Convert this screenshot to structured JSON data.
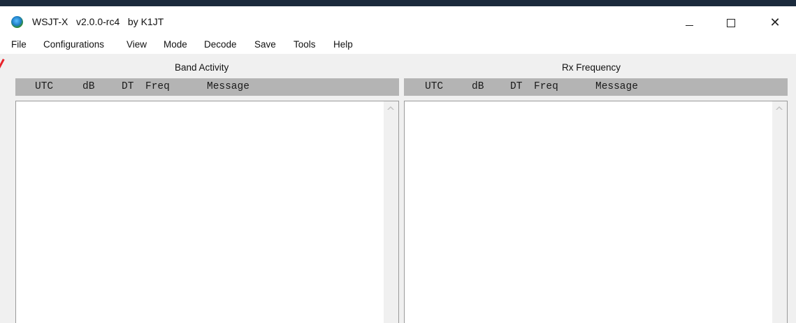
{
  "window": {
    "title": "WSJT-X   v2.0.0-rc4   by K1JT",
    "minimize_glyph": "—",
    "maximize_glyph": "☐",
    "close_glyph": "✕",
    "icon": "wsjtx-globe-icon"
  },
  "menu": {
    "items": [
      "File",
      "Configurations",
      "View",
      "Mode",
      "Decode",
      "Save",
      "Tools",
      "Help"
    ]
  },
  "band_activity": {
    "title": "Band Activity",
    "columns": [
      "UTC",
      "dB",
      "DT",
      "Freq",
      "Message"
    ]
  },
  "rx_frequency": {
    "title": "Rx Frequency",
    "columns": [
      "UTC",
      "dB",
      "DT",
      "Freq",
      "Message"
    ]
  },
  "colors": {
    "header_gray": "#b4b4b4",
    "accent_red": "#e8232a",
    "top_strip": "#1b2a3c"
  }
}
